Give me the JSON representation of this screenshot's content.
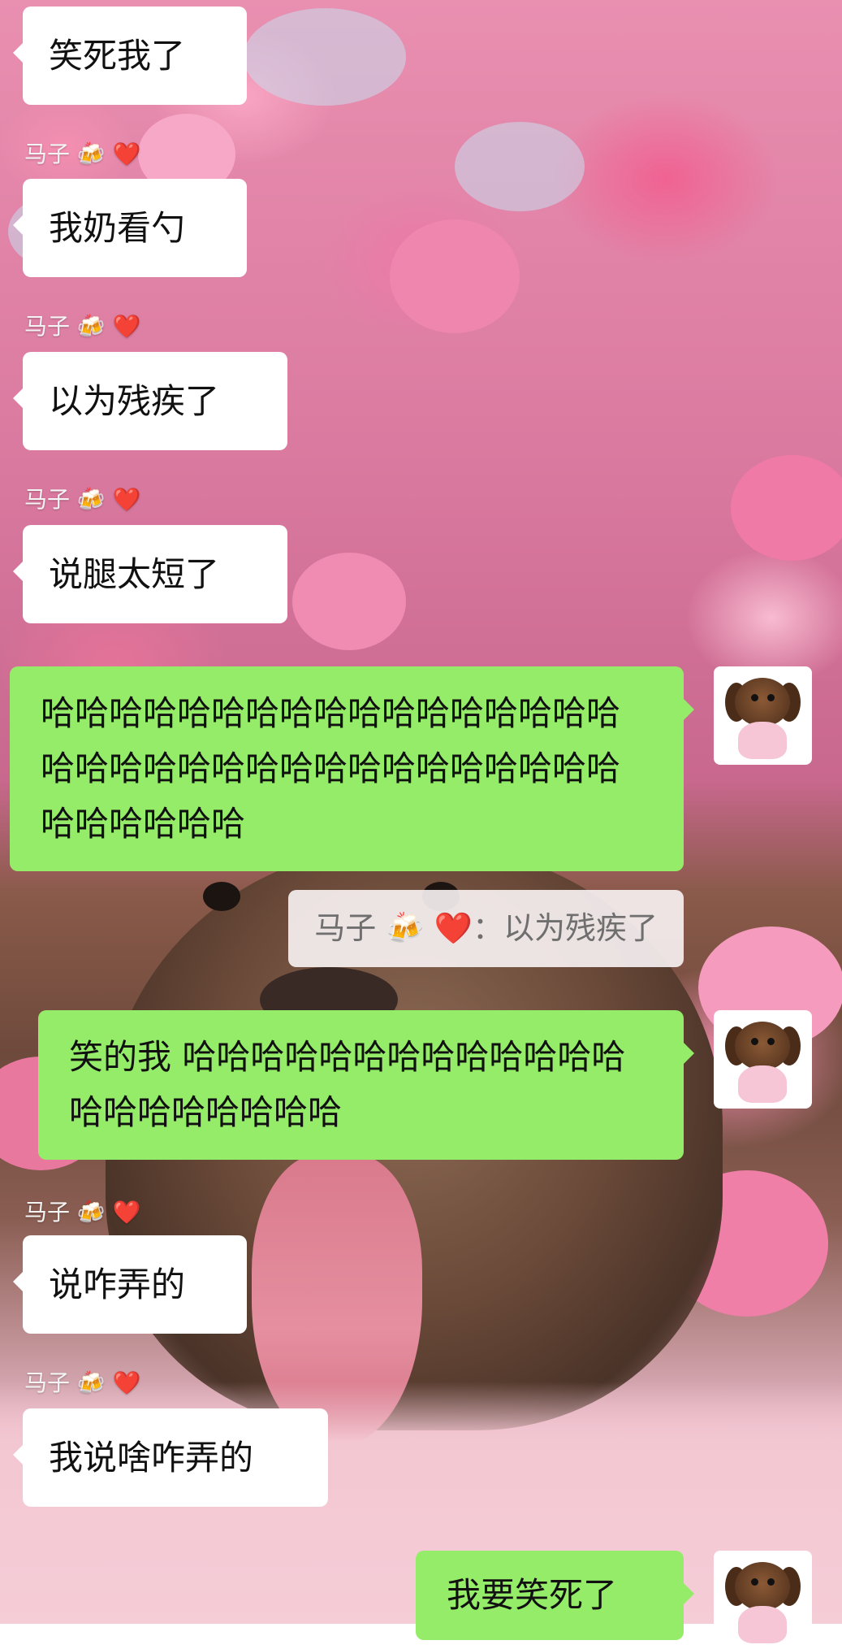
{
  "chat": {
    "messages": [
      {
        "type": "in",
        "text": "笑死我了"
      },
      {
        "type": "sender",
        "text": "马子 🍻 ❤️"
      },
      {
        "type": "in",
        "text": "我奶看勺"
      },
      {
        "type": "sender",
        "text": "马子 🍻 ❤️"
      },
      {
        "type": "in",
        "text": "以为残疾了"
      },
      {
        "type": "sender",
        "text": "马子 🍻 ❤️"
      },
      {
        "type": "in",
        "text": "说腿太短了"
      },
      {
        "type": "out",
        "text": "哈哈哈哈哈哈哈哈哈哈哈哈哈哈哈哈哈哈哈哈哈哈哈哈哈哈哈哈哈哈哈哈哈哈哈哈哈哈哈哈"
      },
      {
        "type": "quote",
        "text": "马子 🍻 ❤️：以为残疾了"
      },
      {
        "type": "out",
        "text": "笑的我 哈哈哈哈哈哈哈哈哈哈哈哈哈哈哈哈哈哈哈哈哈"
      },
      {
        "type": "sender",
        "text": "马子 🍻 ❤️"
      },
      {
        "type": "in",
        "text": "说咋弄的"
      },
      {
        "type": "sender",
        "text": "马子 🍻 ❤️"
      },
      {
        "type": "in",
        "text": "我说啥咋弄的"
      },
      {
        "type": "out",
        "text": "我要笑死了"
      }
    ]
  },
  "colors": {
    "incoming_bubble": "#ffffff",
    "outgoing_bubble": "#95ec69",
    "quote_bg": "#f6f0f1",
    "heart": "#e8261f"
  },
  "icons": {
    "sender_beer": "beer-mugs-icon",
    "sender_heart": "heart-icon",
    "avatar": "puppy-avatar"
  }
}
